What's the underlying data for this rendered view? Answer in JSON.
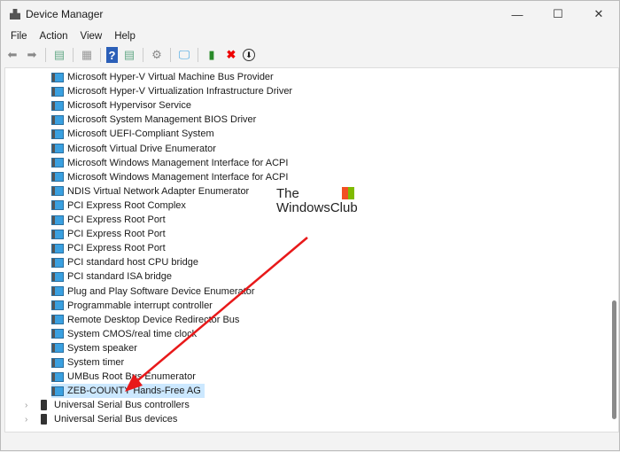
{
  "window": {
    "title": "Device Manager",
    "minimize": "—",
    "maximize": "☐",
    "close": "✕"
  },
  "menu": [
    "File",
    "Action",
    "View",
    "Help"
  ],
  "toolbar": [
    "back",
    "forward",
    "properties-pane",
    "print",
    "help",
    "show-hidden",
    "scan",
    "monitor",
    "update-driver",
    "uninstall",
    "disable"
  ],
  "devices": [
    "Microsoft Hyper-V Virtual Machine Bus Provider",
    "Microsoft Hyper-V Virtualization Infrastructure Driver",
    "Microsoft Hypervisor Service",
    "Microsoft System Management BIOS Driver",
    "Microsoft UEFI-Compliant System",
    "Microsoft Virtual Drive Enumerator",
    "Microsoft Windows Management Interface for ACPI",
    "Microsoft Windows Management Interface for ACPI",
    "NDIS Virtual Network Adapter Enumerator",
    "PCI Express Root Complex",
    "PCI Express Root Port",
    "PCI Express Root Port",
    "PCI Express Root Port",
    "PCI standard host CPU bridge",
    "PCI standard ISA bridge",
    "Plug and Play Software Device Enumerator",
    "Programmable interrupt controller",
    "Remote Desktop Device Redirector Bus",
    "System CMOS/real time clock",
    "System speaker",
    "System timer",
    "UMBus Root Bus Enumerator",
    "ZEB-COUNTY Hands-Free AG"
  ],
  "categories": [
    "Universal Serial Bus controllers",
    "Universal Serial Bus devices"
  ],
  "watermark": {
    "line1": "The",
    "line2": "WindowsClub"
  },
  "colors": {
    "selection": "#cce8ff",
    "arrow": "#e8191a"
  }
}
